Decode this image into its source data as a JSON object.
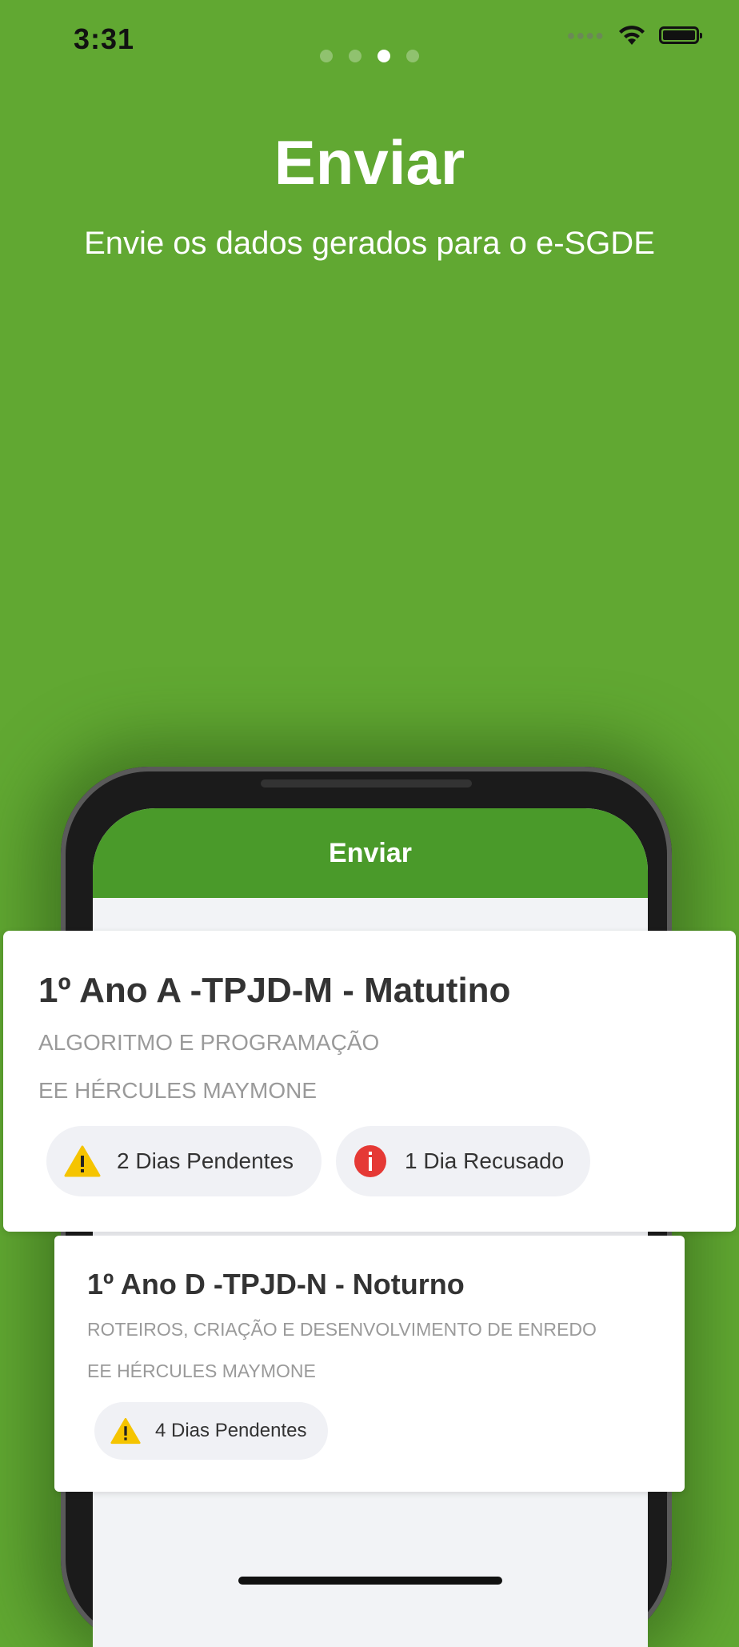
{
  "status_bar": {
    "time": "3:31",
    "signal_icon": "cellular-signal-icon",
    "wifi_icon": "wifi-icon",
    "battery_icon": "battery-icon"
  },
  "pagination": {
    "total": 4,
    "active_index": 2
  },
  "hero": {
    "title": "Enviar",
    "subtitle": "Envie os dados gerados para o e-SGDE"
  },
  "phone_mockup": {
    "header_title": "Enviar"
  },
  "cards": [
    {
      "title": "1º Ano A -TPJD-M - Matutino",
      "subject": "ALGORITMO E PROGRAMAÇÃO",
      "school": "EE HÉRCULES MAYMONE",
      "chips": [
        {
          "icon": "warning-icon",
          "label": "2 Dias Pendentes"
        },
        {
          "icon": "info-icon",
          "label": "1 Dia Recusado"
        }
      ]
    },
    {
      "title": "1º Ano D -TPJD-N - Noturno",
      "subject": "ROTEIROS, CRIAÇÃO E DESENVOLVIMENTO DE ENREDO",
      "school": "EE HÉRCULES MAYMONE",
      "chips": [
        {
          "icon": "warning-icon",
          "label": "4 Dias Pendentes"
        }
      ]
    }
  ],
  "colors": {
    "background": "#61a832",
    "app_header": "#4a9a2a",
    "warning": "#f5c400",
    "error": "#e53935"
  }
}
